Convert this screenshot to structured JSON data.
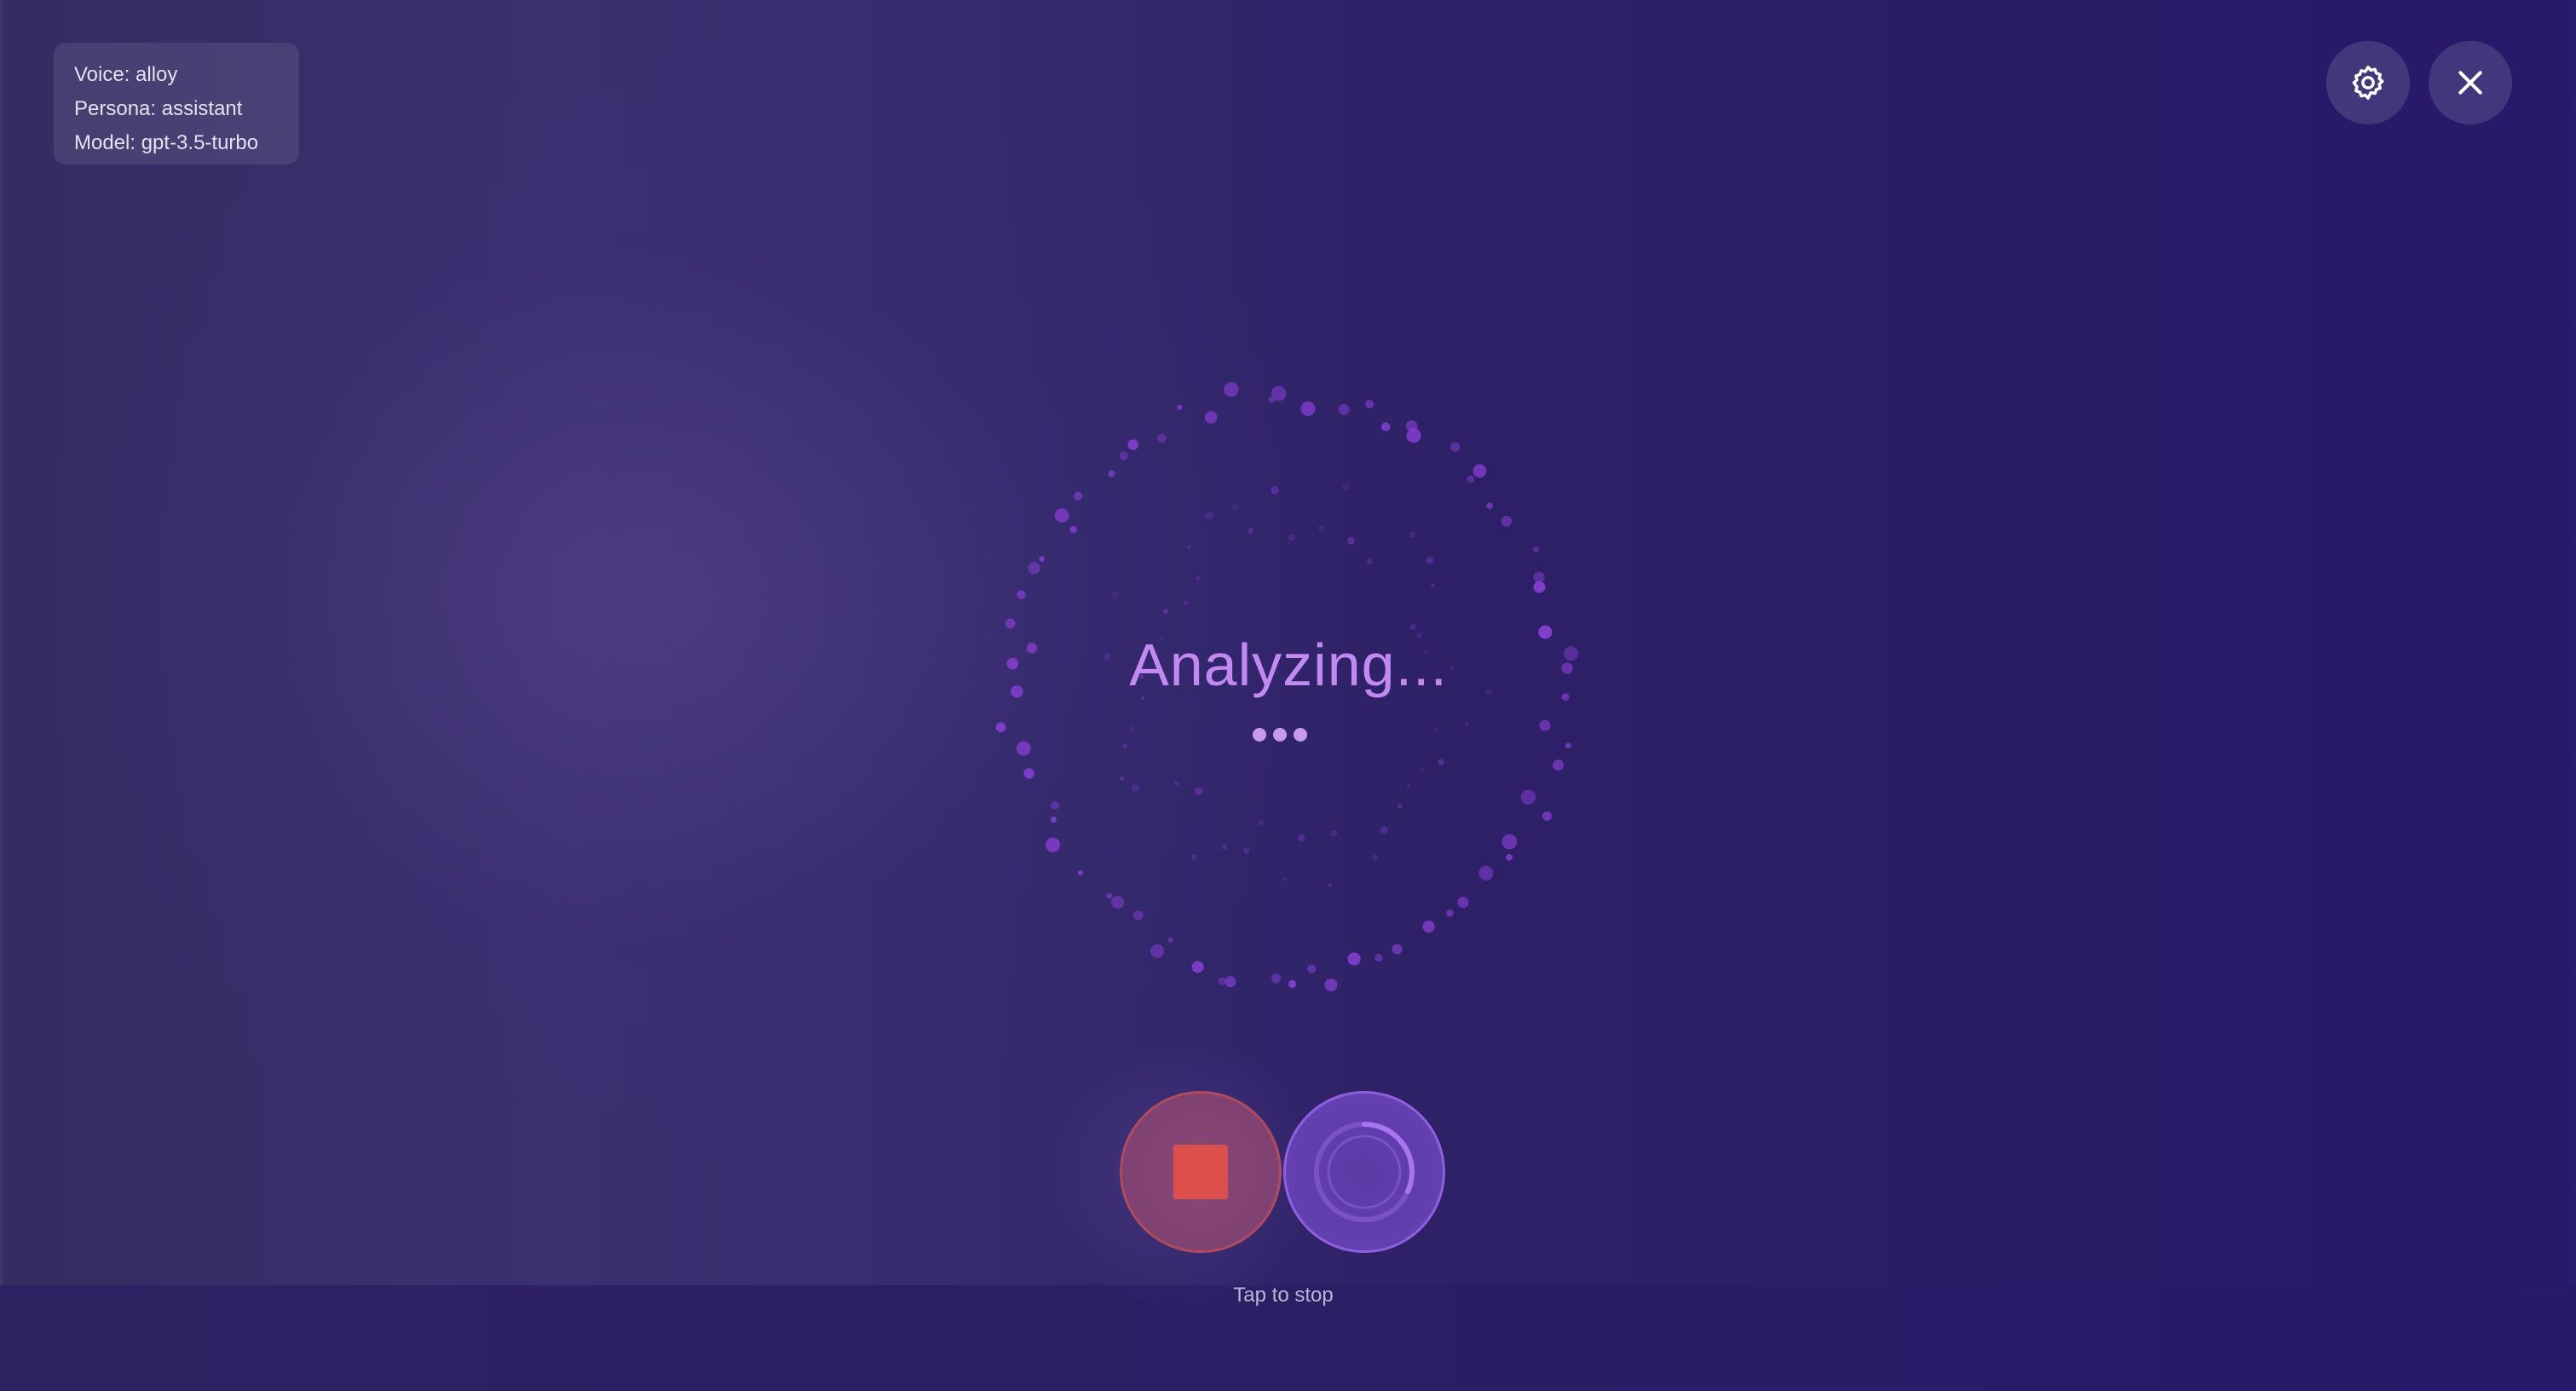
{
  "info": {
    "voice": "Voice: alloy",
    "persona": "Persona: assistant",
    "model": "Model: gpt-3.5-turbo"
  },
  "header": {
    "settings_icon": "gear-icon",
    "close_icon": "close-icon"
  },
  "status": {
    "text": "Analyzing...",
    "typing_indicator_dots": 3
  },
  "controls": {
    "stop_icon": "stop-icon",
    "loading_icon": "loading-spinner-icon",
    "hint": "Tap to stop"
  },
  "colors": {
    "background": "#2a1d66",
    "accent": "#c28af0",
    "particle": "#8a3fd6",
    "stop": "#dd4f4b"
  }
}
